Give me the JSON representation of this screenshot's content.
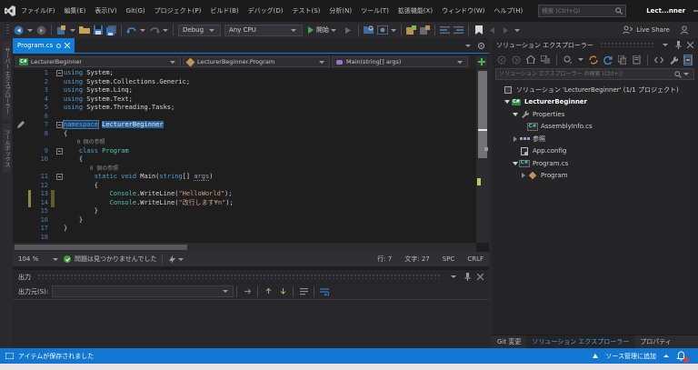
{
  "titlebar": {
    "menus": [
      {
        "label": "ファイル(F)"
      },
      {
        "label": "編集(E)"
      },
      {
        "label": "表示(V)"
      },
      {
        "label": "Git(G)"
      },
      {
        "label": "プロジェクト(P)"
      },
      {
        "label": "ビルド(B)"
      },
      {
        "label": "デバッグ(D)"
      },
      {
        "label": "テスト(S)"
      },
      {
        "label": "分析(N)"
      },
      {
        "label": "ツール(T)"
      },
      {
        "label": "拡張機能(X)"
      },
      {
        "label": "ウィンドウ(W)"
      },
      {
        "label": "ヘルプ(H)"
      }
    ],
    "search_placeholder": "検索 (Ctrl+Q)",
    "window_title": "Lect...nner"
  },
  "toolbar": {
    "debug_target": "Debug",
    "platform": "Any CPU",
    "start_label": "開始",
    "live_share_label": "Live Share"
  },
  "left_tool_tabs": [
    {
      "label": "サーバー エクスプローラー"
    },
    {
      "label": "ツールボックス"
    }
  ],
  "editor": {
    "tab_title": "Program.cs",
    "navbar": {
      "project": "LecturerBeginner",
      "type": "LecturerBeginner.Program",
      "member": "Main(string[] args)"
    },
    "code": {
      "lines": [
        {
          "n": "1",
          "fold": true,
          "segs": [
            [
              "k",
              "using"
            ],
            [
              "t",
              " System;"
            ]
          ]
        },
        {
          "n": "2",
          "segs": [
            [
              "k",
              "using"
            ],
            [
              "t",
              " System.Collections.Generic;"
            ]
          ]
        },
        {
          "n": "3",
          "segs": [
            [
              "k",
              "using"
            ],
            [
              "t",
              " System.Linq;"
            ]
          ]
        },
        {
          "n": "4",
          "segs": [
            [
              "k",
              "using"
            ],
            [
              "t",
              " System.Text;"
            ]
          ]
        },
        {
          "n": "5",
          "segs": [
            [
              "k",
              "using"
            ],
            [
              "t",
              " System.Threading.Tasks;"
            ]
          ]
        },
        {
          "n": "6",
          "segs": []
        },
        {
          "n": "7",
          "fold": true,
          "pencil": true,
          "segs": [
            [
              "selk",
              "namespace"
            ],
            [
              "t",
              " "
            ],
            [
              "selname",
              "LecturerBeginner"
            ]
          ]
        },
        {
          "n": "8",
          "segs": [
            [
              "t",
              "{"
            ]
          ]
        },
        {
          "n": "",
          "segs": [
            [
              "lens",
              "    0 個の参照"
            ]
          ]
        },
        {
          "n": "9",
          "fold": true,
          "segs": [
            [
              "t",
              "    "
            ],
            [
              "k",
              "class"
            ],
            [
              "t",
              " "
            ],
            [
              "ty",
              "Program"
            ]
          ]
        },
        {
          "n": "10",
          "segs": [
            [
              "t",
              "    {"
            ]
          ]
        },
        {
          "n": "",
          "segs": [
            [
              "lens",
              "        0 個の参照"
            ]
          ]
        },
        {
          "n": "11",
          "fold": true,
          "segs": [
            [
              "t",
              "        "
            ],
            [
              "k",
              "static"
            ],
            [
              "t",
              " "
            ],
            [
              "k",
              "void"
            ],
            [
              "t",
              " Main("
            ],
            [
              "k",
              "string"
            ],
            [
              "t",
              "[] "
            ],
            [
              "arg",
              "args"
            ],
            [
              "t",
              ")"
            ]
          ]
        },
        {
          "n": "12",
          "segs": [
            [
              "t",
              "        {"
            ]
          ]
        },
        {
          "n": "13",
          "bar": true,
          "segs": [
            [
              "t",
              "            "
            ],
            [
              "ty",
              "Console"
            ],
            [
              "t",
              ".WriteLine("
            ],
            [
              "s",
              "\"HelloWorld\""
            ],
            [
              "t",
              ");"
            ]
          ]
        },
        {
          "n": "14",
          "bar": true,
          "segs": [
            [
              "t",
              "            "
            ],
            [
              "ty",
              "Console"
            ],
            [
              "t",
              ".WriteLine("
            ],
            [
              "s",
              "\"改行します¥n\""
            ],
            [
              "t",
              ");"
            ]
          ]
        },
        {
          "n": "15",
          "segs": [
            [
              "t",
              "        }"
            ]
          ]
        },
        {
          "n": "16",
          "segs": [
            [
              "t",
              "    }"
            ]
          ]
        },
        {
          "n": "17",
          "segs": [
            [
              "t",
              "}"
            ]
          ]
        },
        {
          "n": "18",
          "segs": []
        }
      ]
    },
    "status": {
      "zoom": "104 %",
      "health_message": "問題は見つかりませんでした",
      "line_label": "行: 7",
      "col_label": "文字: 27",
      "spc": "SPC",
      "eol": "CRLF"
    }
  },
  "output": {
    "title": "出力",
    "source_label": "出力元(S):",
    "source_value": ""
  },
  "solution_explorer": {
    "title": "ソリューション エクスプローラー",
    "search_placeholder": "ソリューション エクスプローラー の検索 (Ctrl+;)",
    "tree": [
      {
        "indent": 0,
        "expander": "none",
        "icon": "solution",
        "label": "ソリューション 'LecturerBeginner' (1/1 プロジェクト)",
        "bold": false
      },
      {
        "indent": 1,
        "expander": "open",
        "icon": "csproj",
        "label": "LecturerBeginner",
        "bold": true
      },
      {
        "indent": 2,
        "expander": "open",
        "icon": "wrench",
        "label": "Properties",
        "bold": false
      },
      {
        "indent": 3,
        "expander": "none",
        "icon": "csfile",
        "label": "AssemblyInfo.cs",
        "bold": false
      },
      {
        "indent": 2,
        "expander": "closed",
        "icon": "refs",
        "label": "参照",
        "bold": false
      },
      {
        "indent": 2,
        "expander": "none",
        "icon": "config",
        "label": "App.config",
        "bold": false
      },
      {
        "indent": 2,
        "expander": "open",
        "icon": "csfile",
        "label": "Program.cs",
        "bold": false
      },
      {
        "indent": 3,
        "expander": "closed",
        "icon": "class",
        "label": "Program",
        "bold": false
      }
    ],
    "bottom_tabs": [
      {
        "label": "Git 変更",
        "active": false
      },
      {
        "label": "ソリューション エクスプローラー",
        "active": true
      },
      {
        "label": "プロパティ",
        "active": false
      }
    ]
  },
  "statusbar": {
    "message": "アイテムが保存されました",
    "add_to_source_label": "ソース管理に追加"
  },
  "colors": {
    "accent_blue": "#0e7ed8",
    "statusbar_blue": "#1177d2",
    "keyword": "#569cd6",
    "type": "#4ec9b0",
    "string": "#d69d85"
  }
}
